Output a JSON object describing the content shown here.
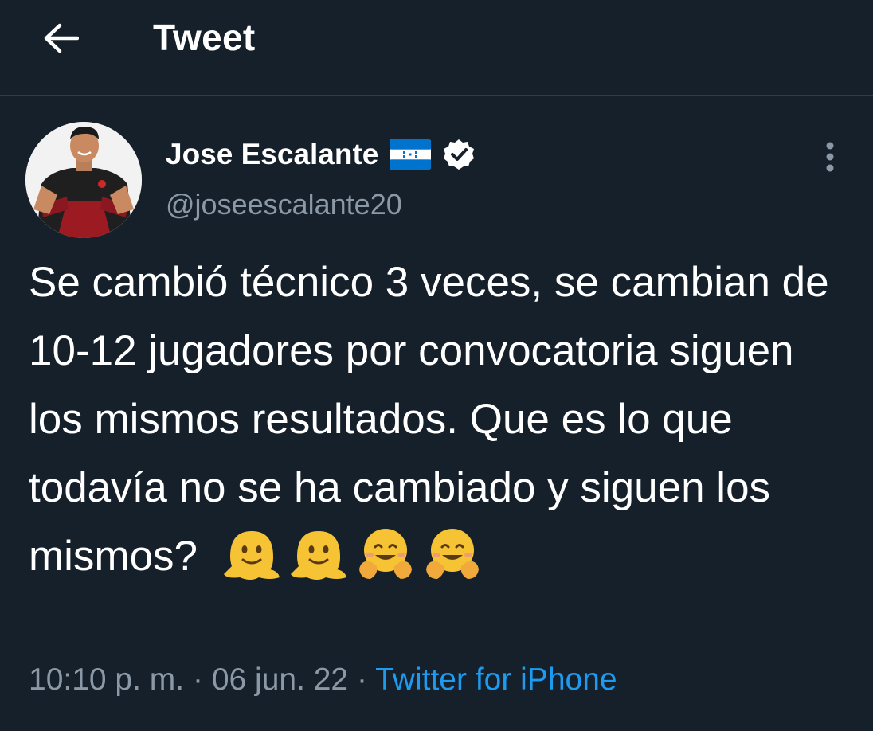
{
  "header": {
    "back_icon": "arrow-left-icon",
    "title": "Tweet"
  },
  "tweet": {
    "avatar_icon": "user-avatar",
    "display_name": "Jose Escalante",
    "flag_icon": "honduras-flag-icon",
    "verified_icon": "verified-badge-icon",
    "handle": "@joseescalante20",
    "more_icon": "more-vertical-icon",
    "text": "Se cambió técnico 3 veces, se cambian de 10-12 jugadores por convocatoria siguen los mismos resultados. Que es lo que todavía no se ha cambiado y siguen los mismos?",
    "emojis": [
      "melting-face-emoji",
      "melting-face-emoji",
      "hugging-face-emoji",
      "hugging-face-emoji"
    ],
    "time": "10:10 p. m.",
    "separator": "·",
    "date": "06 jun. 22",
    "source": "Twitter for iPhone"
  },
  "colors": {
    "background": "#15202b",
    "text": "#ffffff",
    "secondary": "#8b98a5",
    "link": "#1d9bf0",
    "flag_blue": "#0073cf"
  }
}
